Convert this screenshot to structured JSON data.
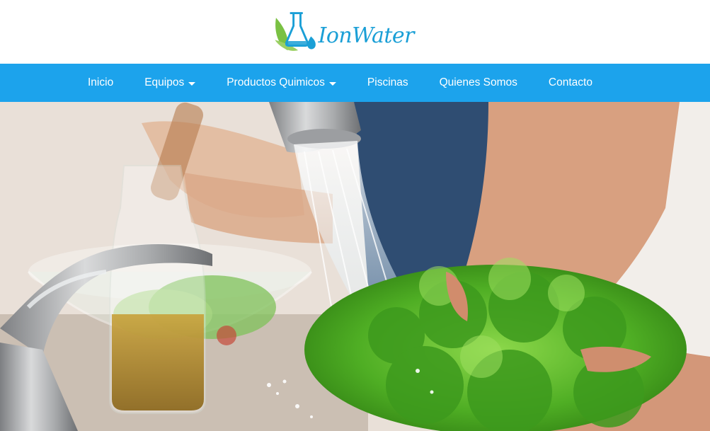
{
  "brand": {
    "name": "IonWater",
    "logo_icon": "flask-leaf-drop-icon",
    "colors": {
      "primary": "#1ca3ec",
      "leaf": "#7ac143",
      "text": "#1a9fd6"
    }
  },
  "nav": {
    "items": [
      {
        "label": "Inicio",
        "dropdown": false
      },
      {
        "label": "Equipos",
        "dropdown": true
      },
      {
        "label": "Productos Quimicos",
        "dropdown": true
      },
      {
        "label": "Piscinas",
        "dropdown": false
      },
      {
        "label": "Quienes Somos",
        "dropdown": false
      },
      {
        "label": "Contacto",
        "dropdown": false
      }
    ]
  },
  "hero": {
    "image_icon": "lettuce-washing-photo"
  }
}
